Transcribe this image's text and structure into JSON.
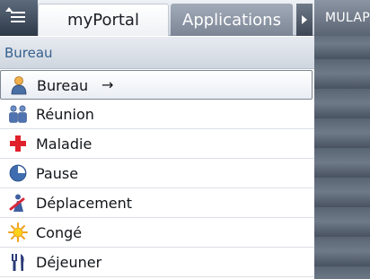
{
  "tabs": {
    "active": "myPortal",
    "inactive": "Applications"
  },
  "side_panel": {
    "title": "MULAP"
  },
  "section": {
    "title": "Bureau"
  },
  "status_list": [
    {
      "label": "Bureau",
      "icon": "person-icon",
      "selected": true,
      "arrow": "→"
    },
    {
      "label": "Réunion",
      "icon": "meeting-people-icon",
      "selected": false
    },
    {
      "label": "Maladie",
      "icon": "red-cross-icon",
      "selected": false
    },
    {
      "label": "Pause",
      "icon": "clock-icon",
      "selected": false
    },
    {
      "label": "Déplacement",
      "icon": "travel-icon",
      "selected": false
    },
    {
      "label": "Congé",
      "icon": "sun-icon",
      "selected": false
    },
    {
      "label": "Déjeuner",
      "icon": "cutlery-icon",
      "selected": false
    }
  ],
  "colors": {
    "section_title": "#36608e",
    "active_tab_bg": "#ffffff",
    "inactive_tab_bg": "#8c96a4",
    "side_panel": "#5a6574"
  }
}
